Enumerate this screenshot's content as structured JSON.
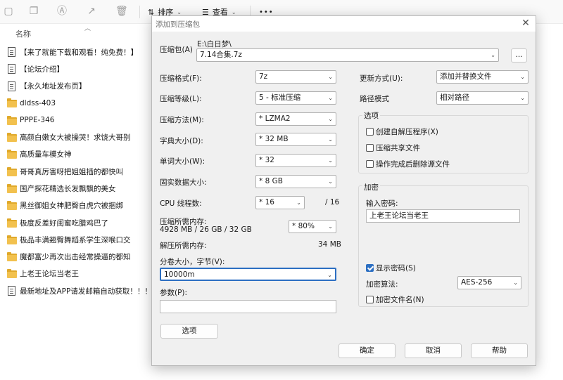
{
  "explorer": {
    "toolbar": {
      "sort_label": "排序",
      "view_label": "查看",
      "more_label": "•••"
    },
    "column_name": "名称",
    "files": [
      {
        "name": "【来了就能下载和观看！纯免费！】",
        "type": "doc"
      },
      {
        "name": "【论坛介绍】",
        "type": "doc"
      },
      {
        "name": "【永久地址发布页】",
        "type": "doc"
      },
      {
        "name": "dldss-403",
        "type": "folder"
      },
      {
        "name": "PPPE-346",
        "type": "folder"
      },
      {
        "name": "高颜白嫩女大被操哭！求饶大哥别",
        "type": "folder"
      },
      {
        "name": "高质量车模女神",
        "type": "folder"
      },
      {
        "name": "哥哥真厉害呀把姐姐插的都快叫",
        "type": "folder"
      },
      {
        "name": "国产探花精选长发飘飘的美女",
        "type": "folder"
      },
      {
        "name": "黑丝御姐女神肥臀白虎穴被捆绑",
        "type": "folder"
      },
      {
        "name": "极度反差好闺蜜吃腊鸡巴了",
        "type": "folder"
      },
      {
        "name": "极品丰满翘臀舞蹈系学生深喉口交",
        "type": "folder"
      },
      {
        "name": "魔都富少再次出击经常操逼的都知",
        "type": "folder"
      },
      {
        "name": "上老王论坛当老王",
        "type": "folder"
      },
      {
        "name": "最新地址及APP请发邮箱自动获取！！！",
        "type": "doc"
      }
    ]
  },
  "dialog": {
    "title": "添加到压缩包",
    "close": "✕",
    "archive_label": "压缩包(A)",
    "archive_path": "E:\\白日梦\\",
    "archive_name": "7.14合集.7z",
    "browse_label": "...",
    "format_label": "压缩格式(F):",
    "format_value": "7z",
    "level_label": "压缩等级(L):",
    "level_value": "5 - 标准压缩",
    "method_label": "压缩方法(M):",
    "method_value": "* LZMA2",
    "dict_label": "字典大小(D):",
    "dict_value": "* 32 MB",
    "word_label": "单词大小(W):",
    "word_value": "* 32",
    "solid_label": "固实数据大小:",
    "solid_value": "* 8 GB",
    "threads_label": "CPU 线程数:",
    "threads_value": "* 16",
    "threads_total": "/ 16",
    "mem_compress_label": "压缩所需内存:",
    "mem_compress_value": "4928 MB / 26 GB / 32 GB",
    "mem_percent": "* 80%",
    "mem_decompress_label": "解压所需内存:",
    "mem_decompress_value": "34 MB",
    "split_label": "分卷大小，字节(V):",
    "split_value": "10000m",
    "params_label": "参数(P):",
    "params_value": "",
    "options_button": "选项",
    "update_label": "更新方式(U):",
    "update_value": "添加并替换文件",
    "path_label": "路径模式",
    "path_value": "相对路径",
    "options_group": "选项",
    "opt_sfx": {
      "label": "创建自解压程序(X)",
      "checked": false
    },
    "opt_shared": {
      "label": "压缩共享文件",
      "checked": false
    },
    "opt_delete": {
      "label": "操作完成后删除源文件",
      "checked": false
    },
    "encrypt_group": "加密",
    "password_label": "输入密码:",
    "password_value": "上老王论坛当老王",
    "show_password": {
      "label": "显示密码(S)",
      "checked": true
    },
    "enc_method_label": "加密算法:",
    "enc_method_value": "AES-256",
    "encrypt_names": {
      "label": "加密文件名(N)",
      "checked": false
    },
    "ok_label": "确定",
    "cancel_label": "取消",
    "help_label": "帮助"
  }
}
